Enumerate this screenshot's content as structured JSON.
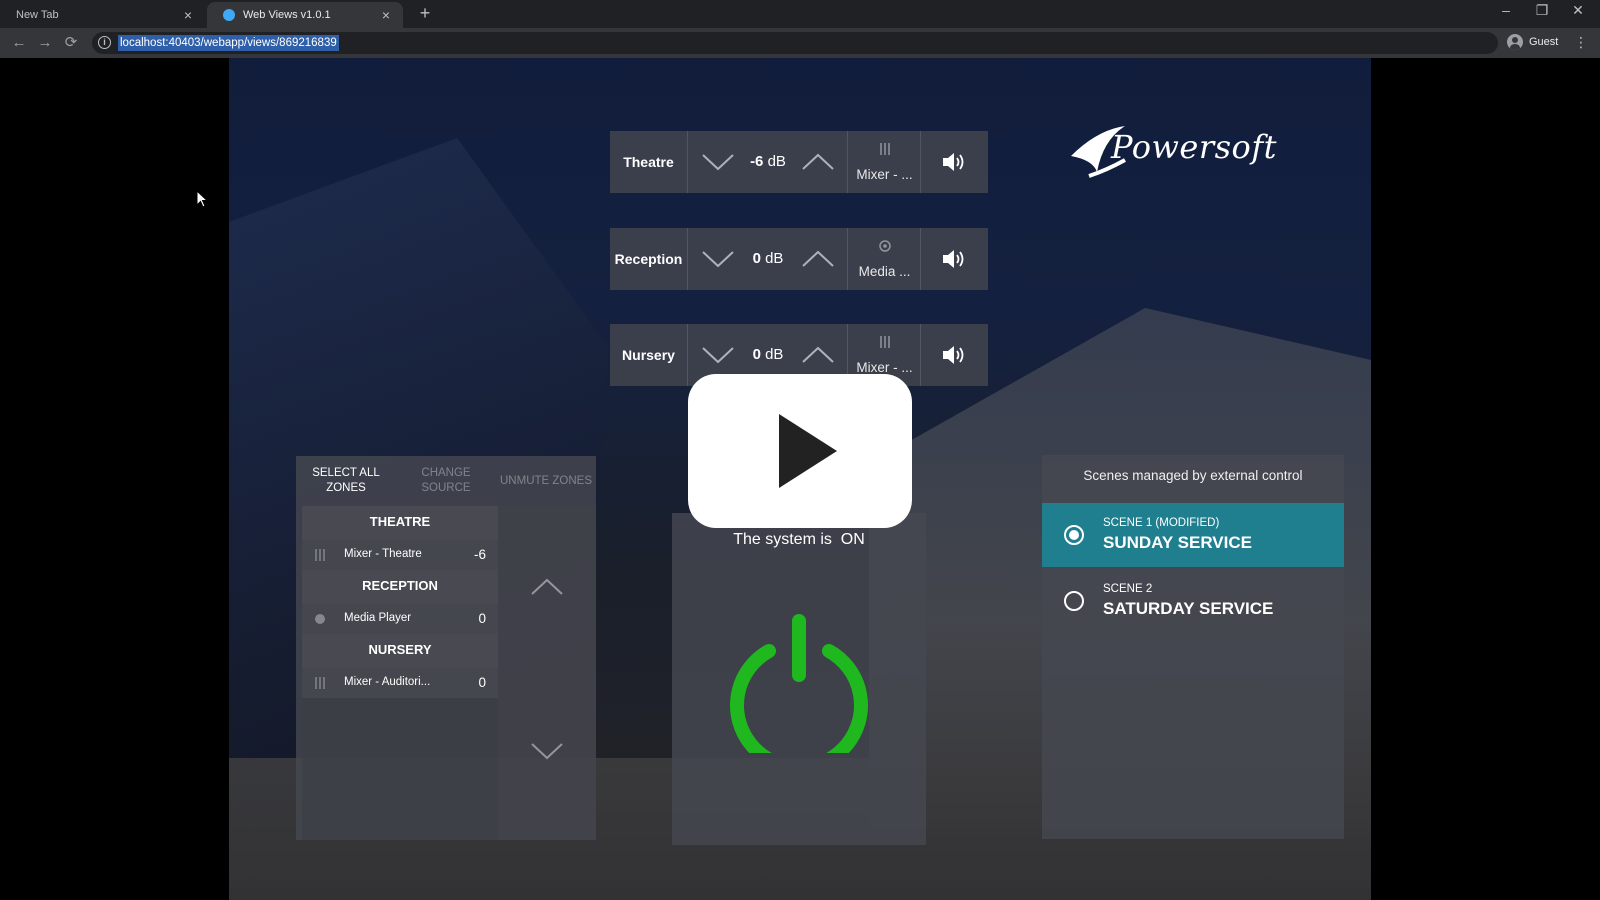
{
  "browser": {
    "tabs": [
      {
        "title": "New Tab"
      },
      {
        "title": "Web Views v1.0.1"
      }
    ],
    "new_tab": "+",
    "url": "localhost:40403/webapp/views/869216839",
    "profile": "Guest"
  },
  "app": {
    "logo": "Powersoft",
    "zones": [
      {
        "name": "Theatre",
        "db_value": "-6",
        "db_unit": "dB",
        "source": "Mixer - ...",
        "source_icon": "mixer-icon"
      },
      {
        "name": "Reception",
        "db_value": "0",
        "db_unit": "dB",
        "source": "Media ...",
        "source_icon": "media-icon"
      },
      {
        "name": "Nursery",
        "db_value": "0",
        "db_unit": "dB",
        "source": "Mixer - ...",
        "source_icon": "mixer-icon"
      }
    ],
    "zone_panel": {
      "select_all": "SELECT ALL ZONES",
      "change_source": "CHANGE SOURCE",
      "unmute_zones": "UNMUTE ZONES",
      "groups": [
        {
          "title": "THEATRE",
          "source": "Mixer - Theatre",
          "value": "-6"
        },
        {
          "title": "RECEPTION",
          "source": "Media Player",
          "value": "0"
        },
        {
          "title": "NURSERY",
          "source": "Mixer - Auditori...",
          "value": "0"
        }
      ]
    },
    "power": {
      "status_prefix": "The system is",
      "status_value": "ON",
      "color": "#1fb81f"
    },
    "scenes": {
      "title": "Scenes managed by external control",
      "items": [
        {
          "sub": "SCENE 1 (MODIFIED)",
          "name": "SUNDAY SERVICE",
          "active": true
        },
        {
          "sub": "SCENE 2",
          "name": "SATURDAY SERVICE",
          "active": false
        }
      ],
      "accent": "#1f7f8f"
    }
  }
}
